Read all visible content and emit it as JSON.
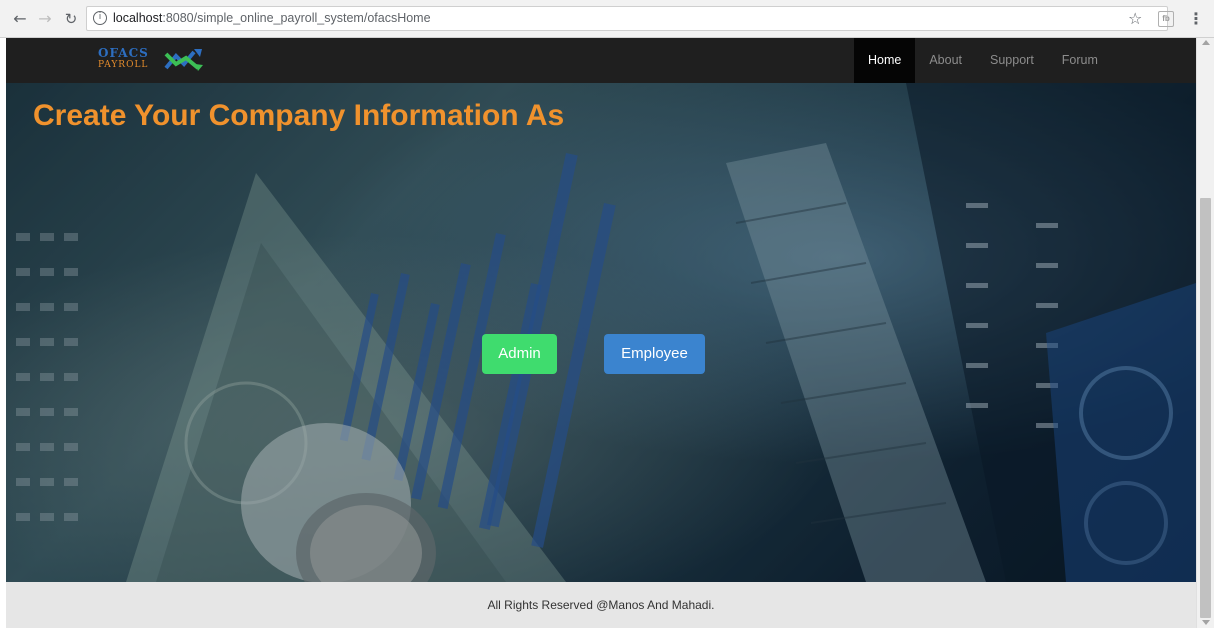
{
  "browser": {
    "url_host": "localhost",
    "url_path": ":8080/simple_online_payroll_system/ofacsHome",
    "back_icon": "back-arrow-icon",
    "forward_icon": "forward-arrow-icon",
    "reload_icon": "reload-icon",
    "info_icon": "info-icon",
    "star_icon": "star-icon",
    "extension_label": "fb",
    "menu_icon": "kebab-menu-icon"
  },
  "navbar": {
    "logo_top": "OFACS",
    "logo_bottom": "PAYROLL",
    "items": [
      {
        "label": "Home",
        "active": true
      },
      {
        "label": "About",
        "active": false
      },
      {
        "label": "Support",
        "active": false
      },
      {
        "label": "Forum",
        "active": false
      }
    ]
  },
  "hero": {
    "title": "Create Your Company Information As",
    "buttons": {
      "admin_label": "Admin",
      "employee_label": "Employee"
    }
  },
  "footer": {
    "text": "All Rights Reserved @Manos And Mahadi."
  },
  "colors": {
    "title": "#f0922d",
    "admin_button": "#3fdc6e",
    "employee_button": "#3b84cf",
    "navbar": "#1f1f1f",
    "footer": "#e6e6e6"
  }
}
